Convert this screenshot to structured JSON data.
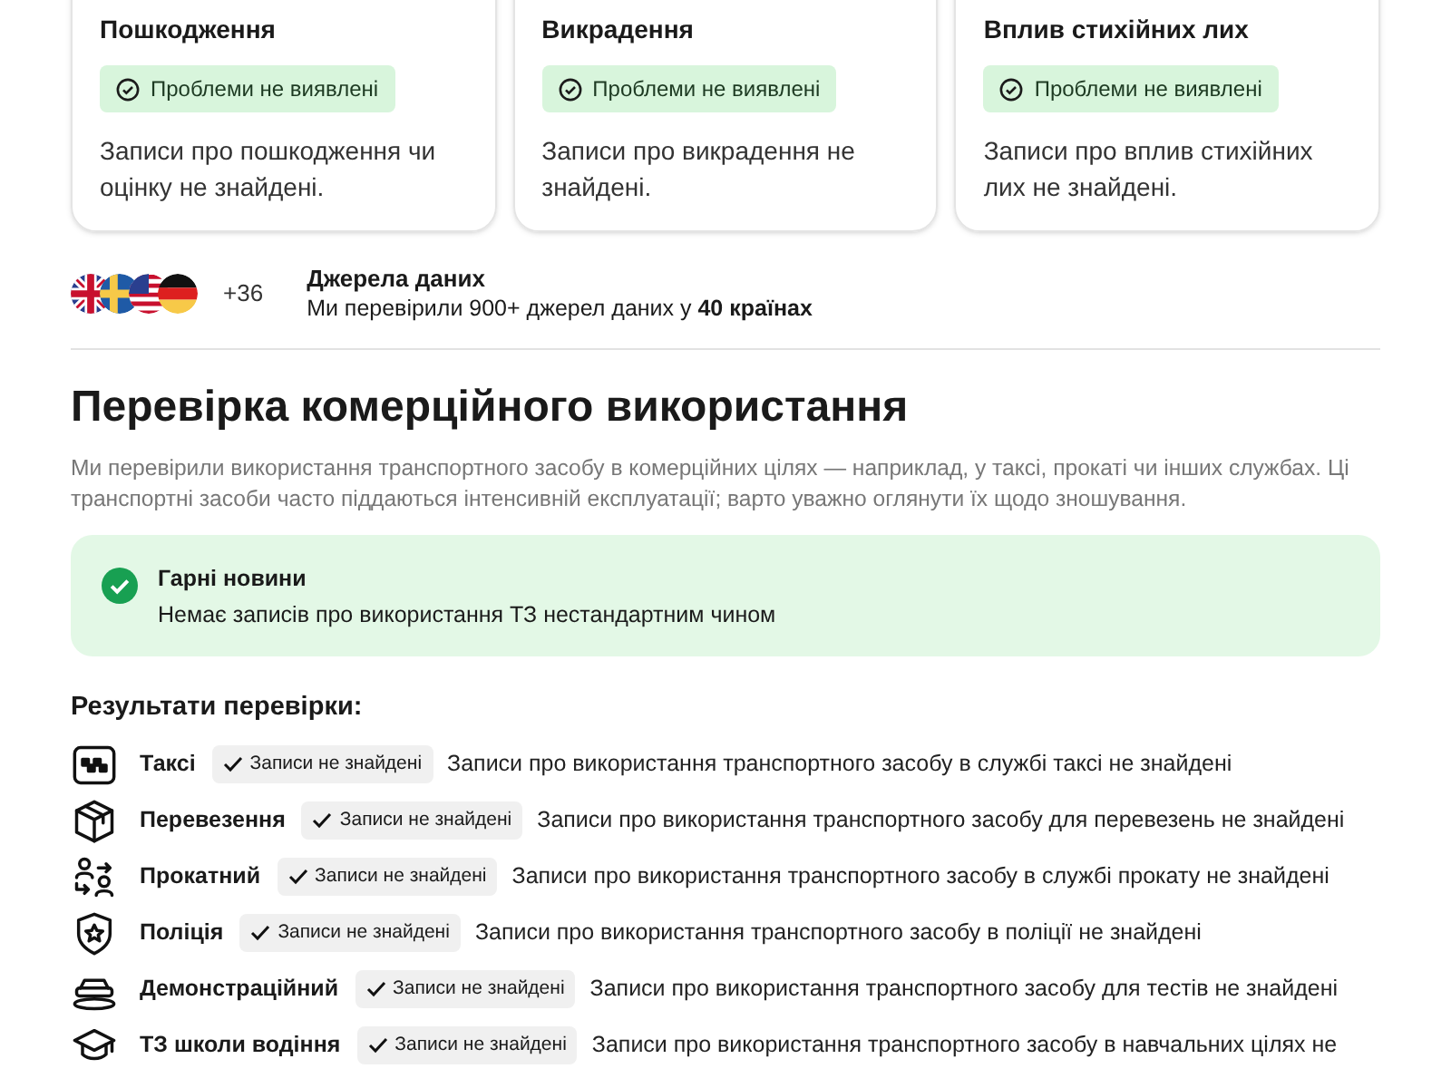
{
  "cards": [
    {
      "title": "Пошкодження",
      "badge": "Проблеми не виявлені",
      "text": "Записи про пошкодження чи оцінку не знайдені."
    },
    {
      "title": "Викрадення",
      "badge": "Проблеми не виявлені",
      "text": "Записи про викрадення не знайдені."
    },
    {
      "title": "Вплив стихійних лих",
      "badge": "Проблеми не виявлені",
      "text": "Записи про вплив стихійних лих не знайдені."
    }
  ],
  "sources": {
    "flags": [
      {
        "kind": "uk"
      },
      {
        "kind": "se"
      },
      {
        "kind": "us"
      },
      {
        "kind": "de"
      }
    ],
    "more": "+36",
    "title": "Джерела даних",
    "text": "Ми перевірили 900+ джерел даних у **40 країнах**"
  },
  "section": {
    "title": "Перевірка комерційного використання",
    "description": "Ми перевірили використання транспортного засобу в комерційних цілях — наприклад, у таксі, прокаті чи інших службах. Ці транспортні засоби часто піддаються інтенсивній експлуатації; варто уважно оглянути їх щодо зношування.",
    "notice": {
      "title": "Гарні новини",
      "text": "Немає записів про використання ТЗ нестандартним чином"
    },
    "results_title": "Результати перевірки:",
    "results": [
      {
        "kind": "taxi",
        "label": "Таксі",
        "badge": "Записи не знайдені",
        "text": "Записи про використання транспортного засобу в службі таксі не знайдені"
      },
      {
        "kind": "box",
        "label": "Перевезення",
        "badge": "Записи не знайдені",
        "text": "Записи про використання транспортного засобу для перевезень не знайдені"
      },
      {
        "kind": "rental",
        "label": "Прокатний",
        "badge": "Записи не знайдені",
        "text": "Записи про використання транспортного засобу в службі прокату не знайдені"
      },
      {
        "kind": "police",
        "label": "Поліція",
        "badge": "Записи не знайдені",
        "text": "Записи про використання транспортного засобу в поліції не знайдені"
      },
      {
        "kind": "demo",
        "label": "Демонстраційний",
        "badge": "Записи не знайдені",
        "text": "Записи про використання транспортного засобу для тестів не знайдені"
      },
      {
        "kind": "school",
        "label": "ТЗ школи водіння",
        "badge": "Записи не знайдені",
        "text": "Записи про використання транспортного засобу в навчальних цілях не"
      }
    ]
  }
}
